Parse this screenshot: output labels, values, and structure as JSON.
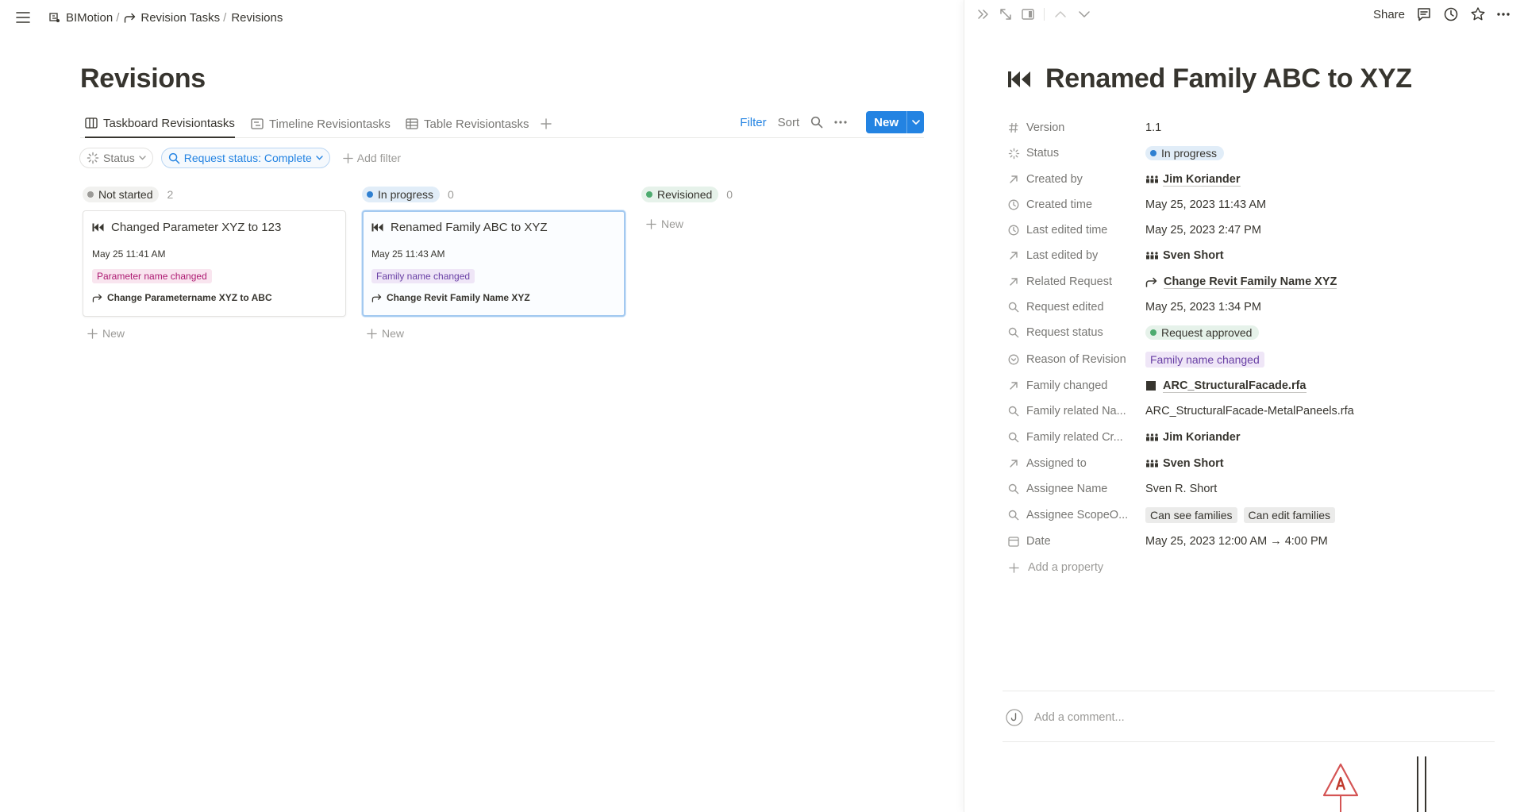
{
  "breadcrumb": {
    "workspace": "BIMotion",
    "parent": "Revision Tasks",
    "current": "Revisions"
  },
  "page": {
    "title": "Revisions"
  },
  "views": {
    "tabs": [
      {
        "label": "Taskboard Revisiontasks",
        "icon": "board-icon",
        "active": true
      },
      {
        "label": "Timeline Revisiontasks",
        "icon": "timeline-icon",
        "active": false
      },
      {
        "label": "Table Revisiontasks",
        "icon": "table-icon",
        "active": false
      }
    ],
    "filter_label": "Filter",
    "sort_label": "Sort",
    "new_label": "New"
  },
  "filters": {
    "status_label": "Status",
    "request_status_label": "Request status: Complete",
    "add_filter_label": "Add filter"
  },
  "board": {
    "add_new_label": "New",
    "columns": [
      {
        "status": "Not started",
        "count": "2",
        "color": "#9b9a97",
        "bg": "#f1f1ef",
        "cards": [
          {
            "title": "Changed Parameter XYZ to 123",
            "date": "May 25 11:41 AM",
            "tag": "Parameter name changed",
            "tag_bg": "#f9e5ef",
            "tag_color": "#ad1a72",
            "relation": "Change Parametername XYZ to ABC"
          }
        ]
      },
      {
        "status": "In progress",
        "count": "0",
        "color": "#2f80d1",
        "bg": "#e1edf8",
        "cards": [
          {
            "title": "Renamed Family ABC to XYZ",
            "date": "May 25 11:43 AM",
            "tag": "Family name changed",
            "tag_bg": "#efe6f7",
            "tag_color": "#6940a5",
            "relation": "Change Revit Family Name XYZ"
          }
        ]
      },
      {
        "status": "Revisioned",
        "count": "0",
        "color": "#4dab6f",
        "bg": "#e6f2ea",
        "cards": []
      }
    ]
  },
  "panel": {
    "share_label": "Share",
    "title": "Renamed Family ABC to XYZ",
    "properties": {
      "version": {
        "name": "Version",
        "value": "1.1"
      },
      "status": {
        "name": "Status",
        "value": "In progress"
      },
      "created_by": {
        "name": "Created by",
        "value": "Jim Koriander"
      },
      "created_time": {
        "name": "Created time",
        "value": "May 25, 2023 11:43 AM"
      },
      "last_edited": {
        "name": "Last edited time",
        "value": "May 25, 2023 2:47 PM"
      },
      "last_edited_by": {
        "name": "Last edited by",
        "value": "Sven Short"
      },
      "related_req": {
        "name": "Related Request",
        "value": "Change Revit Family Name XYZ"
      },
      "req_edited": {
        "name": "Request edited",
        "value": "May 25, 2023 1:34 PM"
      },
      "req_status": {
        "name": "Request status",
        "value": "Request approved"
      },
      "reason": {
        "name": "Reason of Revision",
        "value": "Family name changed"
      },
      "family_changed": {
        "name": "Family changed",
        "value": "ARC_StructuralFacade.rfa"
      },
      "family_name": {
        "name": "Family related Na...",
        "value": "ARC_StructuralFacade-MetalPaneels.rfa"
      },
      "family_creator": {
        "name": "Family related Cr...",
        "value": "Jim Koriander"
      },
      "assigned_to": {
        "name": "Assigned to",
        "value": "Sven Short"
      },
      "assignee_name": {
        "name": "Assignee Name",
        "value": "Sven R. Short"
      },
      "assignee_scope": {
        "name": "Assignee ScopeO...",
        "tags": [
          "Can see families",
          "Can edit families"
        ]
      },
      "date": {
        "name": "Date",
        "value": "May 25, 2023 12:00 AM → 4:00 PM"
      }
    },
    "add_property_label": "Add a property",
    "comment_placeholder": "Add a comment..."
  },
  "colors": {
    "accent": "#2383e2",
    "in_progress_bg": "#e1edf8",
    "approved_bg": "#e6f2ea",
    "approved_dot": "#4dab6f",
    "family_tag_bg": "#efe6f7",
    "family_tag_fg": "#6940a5",
    "scope_tag_bg": "#ebebea"
  }
}
